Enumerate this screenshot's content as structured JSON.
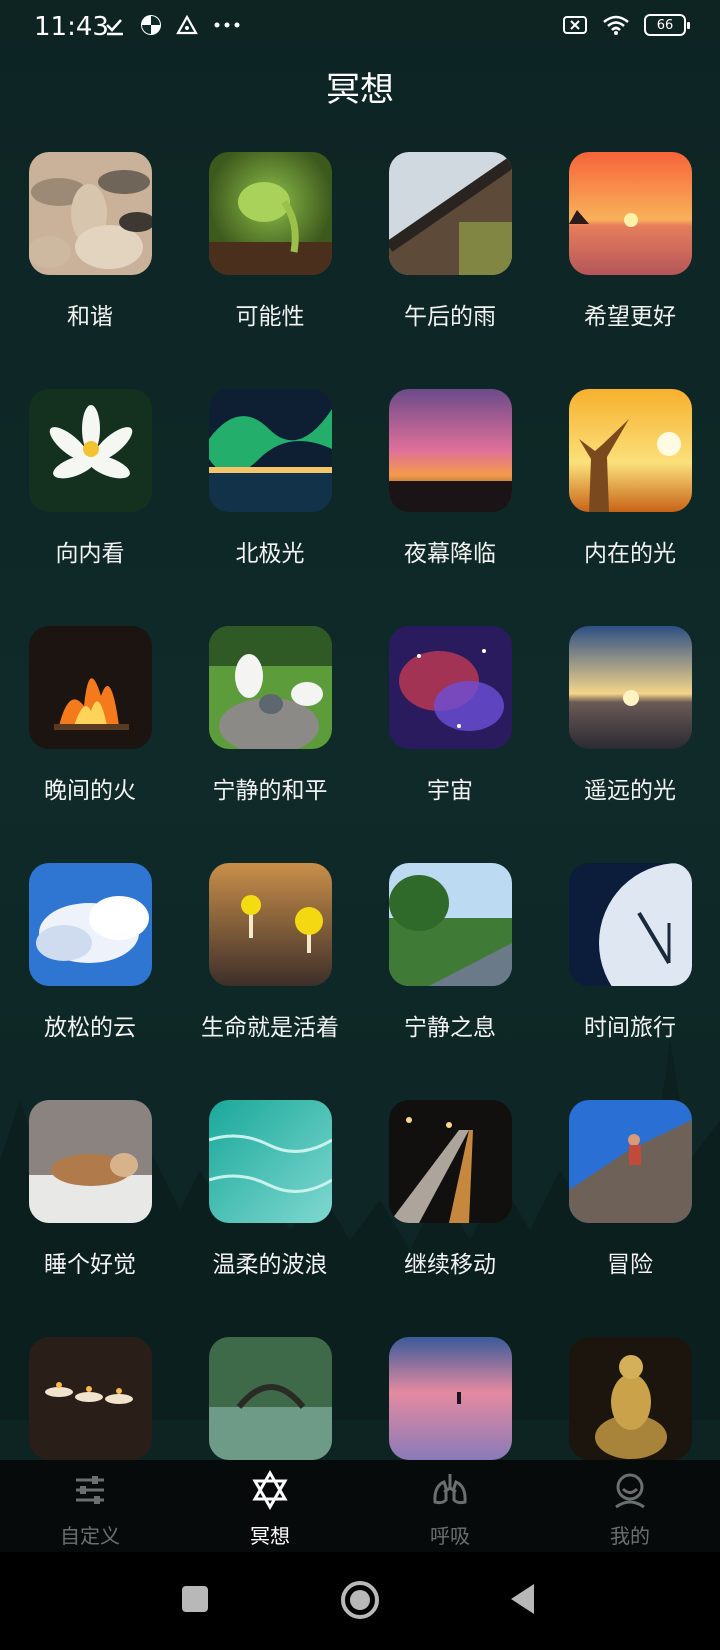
{
  "status_bar": {
    "time": "11:43",
    "battery": "66",
    "icons": [
      "check-download-icon",
      "pinwheel-icon",
      "triangle-app-icon",
      "more-dots-icon",
      "no-sim-icon",
      "wifi-icon",
      "battery-icon"
    ]
  },
  "page": {
    "title": "冥想"
  },
  "meditations": [
    {
      "label": "和谐",
      "image": "pebbles"
    },
    {
      "label": "可能性",
      "image": "sprout"
    },
    {
      "label": "午后的雨",
      "image": "roof-tiles"
    },
    {
      "label": "希望更好",
      "image": "sunset-sea"
    },
    {
      "label": "向内看",
      "image": "water-lily"
    },
    {
      "label": "北极光",
      "image": "aurora"
    },
    {
      "label": "夜幕降临",
      "image": "dusk-city"
    },
    {
      "label": "内在的光",
      "image": "sunrise-person"
    },
    {
      "label": "晚间的火",
      "image": "campfire"
    },
    {
      "label": "宁静的和平",
      "image": "doves"
    },
    {
      "label": "宇宙",
      "image": "nebula"
    },
    {
      "label": "遥远的光",
      "image": "horizon-sun"
    },
    {
      "label": "放松的云",
      "image": "clouds"
    },
    {
      "label": "生命就是活着",
      "image": "yellow-mushrooms"
    },
    {
      "label": "宁静之息",
      "image": "road-trees"
    },
    {
      "label": "时间旅行",
      "image": "clock"
    },
    {
      "label": "睡个好觉",
      "image": "sleeping-cat"
    },
    {
      "label": "温柔的波浪",
      "image": "turquoise-water"
    },
    {
      "label": "继续移动",
      "image": "night-highway"
    },
    {
      "label": "冒险",
      "image": "rock-climber"
    },
    {
      "label": "",
      "image": "candles"
    },
    {
      "label": "",
      "image": "stone-bridge"
    },
    {
      "label": "",
      "image": "lake-fisherman"
    },
    {
      "label": "",
      "image": "buddha-statue"
    }
  ],
  "bottom_nav": [
    {
      "label": "自定义",
      "icon": "sliders-icon",
      "active": false
    },
    {
      "label": "冥想",
      "icon": "star-of-david-icon",
      "active": true
    },
    {
      "label": "呼吸",
      "icon": "lungs-icon",
      "active": false
    },
    {
      "label": "我的",
      "icon": "profile-icon",
      "active": false
    }
  ],
  "system_nav": [
    "recent-apps-icon",
    "home-icon",
    "back-icon"
  ],
  "colors": {
    "background": "#0f2a29",
    "nav_bg": "#060a0a",
    "active": "#ffffff",
    "inactive": "#6a6f70"
  }
}
